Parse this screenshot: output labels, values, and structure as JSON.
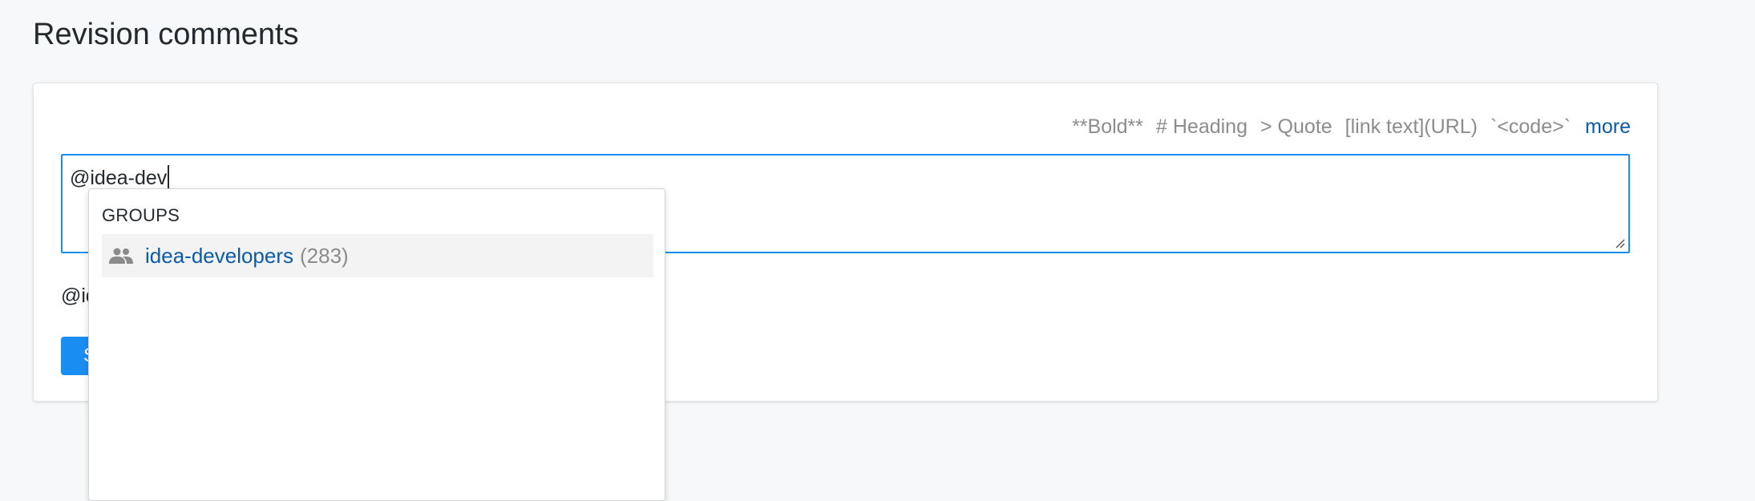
{
  "page": {
    "title": "Revision comments"
  },
  "markdown_hints": {
    "bold": "**Bold**",
    "heading": "# Heading",
    "quote": "> Quote",
    "link": "[link text](URL)",
    "code": "`<code>`",
    "more": "more"
  },
  "comment": {
    "value": "@idea-dev"
  },
  "preview": {
    "text": "@idea-dev"
  },
  "submit": {
    "label": "Save"
  },
  "mention_dropdown": {
    "section_header": "GROUPS",
    "items": [
      {
        "name": "idea-developers",
        "count": "(283)",
        "icon": "group-icon"
      }
    ]
  },
  "colors": {
    "accent": "#1a8df2",
    "link": "#0b5ba6",
    "muted": "#8c8c8c",
    "background": "#f6f8fa"
  }
}
